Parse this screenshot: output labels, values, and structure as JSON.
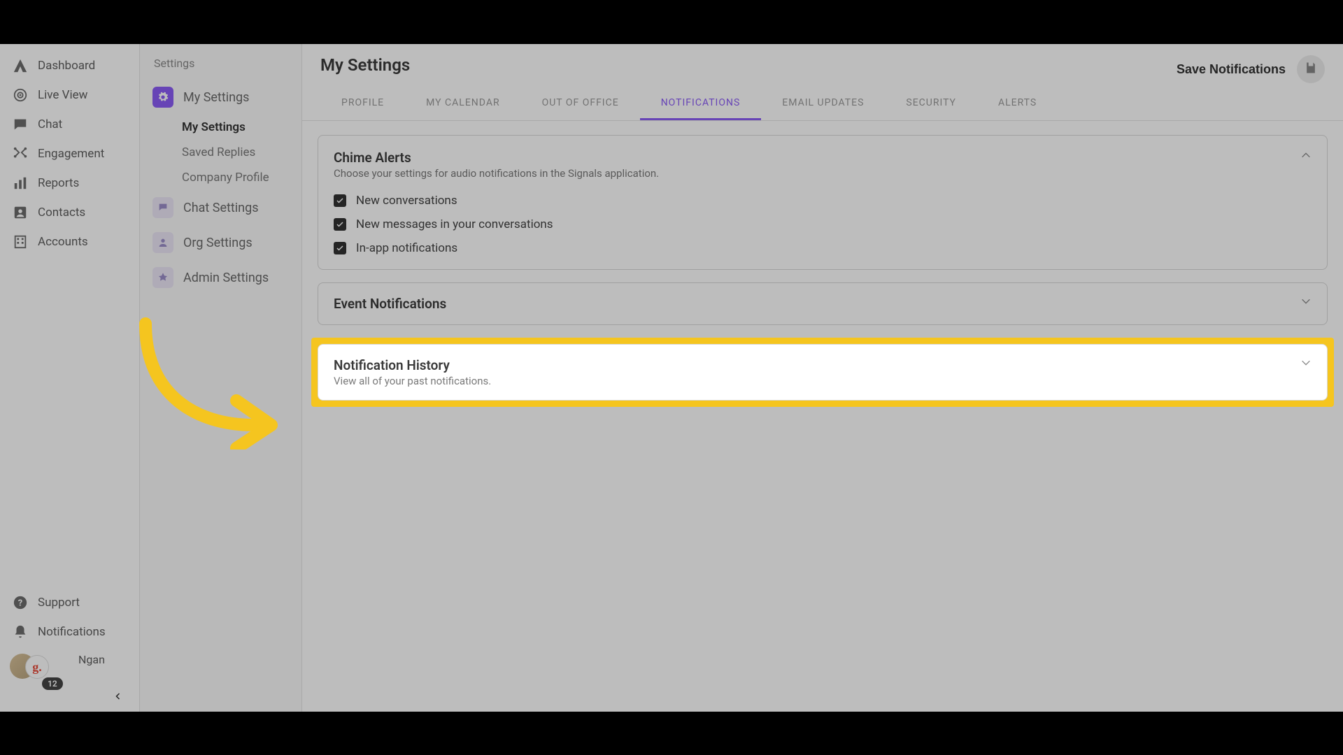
{
  "nav": {
    "items": [
      {
        "label": "Dashboard",
        "icon": "logo"
      },
      {
        "label": "Live View",
        "icon": "target"
      },
      {
        "label": "Chat",
        "icon": "chat"
      },
      {
        "label": "Engagement",
        "icon": "engagement"
      },
      {
        "label": "Reports",
        "icon": "bar-chart"
      },
      {
        "label": "Contacts",
        "icon": "contact"
      },
      {
        "label": "Accounts",
        "icon": "building"
      }
    ],
    "bottom": [
      {
        "label": "Support",
        "icon": "help"
      },
      {
        "label": "Notifications",
        "icon": "bell"
      }
    ],
    "user": {
      "name": "Ngan",
      "badge": "12",
      "avatar_letter": "g."
    }
  },
  "subnav": {
    "title": "Settings",
    "items": [
      {
        "label": "My Settings",
        "children": [
          "My Settings",
          "Saved Replies",
          "Company Profile"
        ]
      },
      {
        "label": "Chat Settings"
      },
      {
        "label": "Org Settings"
      },
      {
        "label": "Admin Settings"
      }
    ]
  },
  "page": {
    "title": "My Settings",
    "save_label": "Save Notifications"
  },
  "tabs": [
    "PROFILE",
    "MY CALENDAR",
    "OUT OF OFFICE",
    "NOTIFICATIONS",
    "EMAIL UPDATES",
    "SECURITY",
    "ALERTS"
  ],
  "tabs_active_index": 3,
  "panels": {
    "chime": {
      "title": "Chime Alerts",
      "desc": "Choose your settings for audio notifications in the Signals application.",
      "options": [
        "New conversations",
        "New messages in your conversations",
        "In-app notifications"
      ]
    },
    "event": {
      "title": "Event Notifications"
    },
    "history": {
      "title": "Notification History",
      "desc": "View all of your past notifications."
    }
  }
}
